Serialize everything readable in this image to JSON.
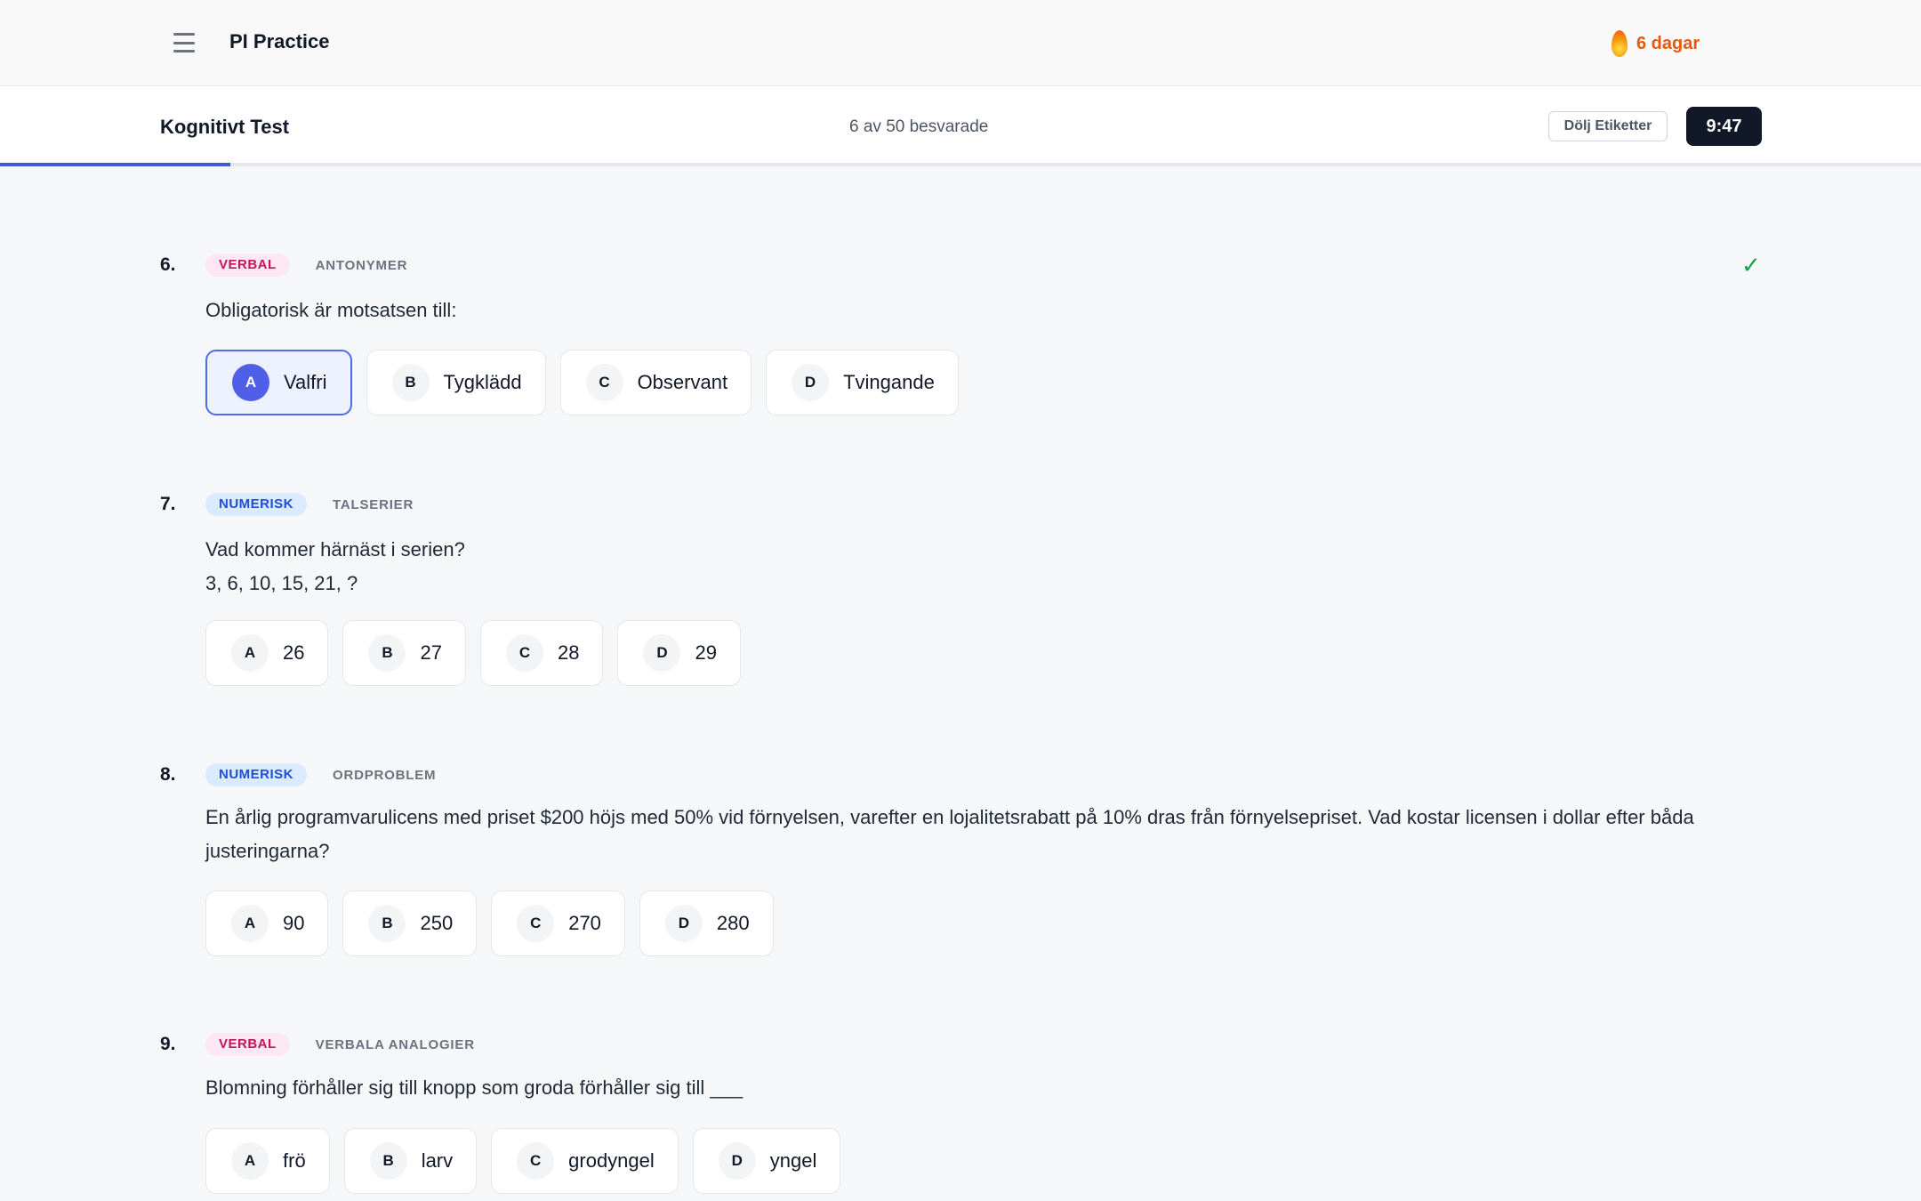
{
  "app": {
    "title": "PI Practice",
    "streak": "6 dagar"
  },
  "test": {
    "title": "Kognitivt Test",
    "answered": "6 av 50 besvarade",
    "hide_labels": "Dölj Etiketter",
    "timer": "9:47",
    "progress_percent": 12
  },
  "colors": {
    "accent": "#3b5bdb",
    "verbal": "#be185d",
    "numeric": "#1d4ed8",
    "streak": "#ea580c"
  },
  "questions": [
    {
      "num": "6.",
      "category": "VERBAL",
      "subcategory": "ANTONYMER",
      "answered_icon": "✓",
      "text": "Obligatorisk är motsatsen till:",
      "options": [
        {
          "letter": "A",
          "text": "Valfri",
          "selected": true
        },
        {
          "letter": "B",
          "text": "Tygklädd"
        },
        {
          "letter": "C",
          "text": "Observant"
        },
        {
          "letter": "D",
          "text": "Tvingande"
        }
      ]
    },
    {
      "num": "7.",
      "category": "NUMERISK",
      "subcategory": "TALSERIER",
      "text": "Vad kommer härnäst i serien?",
      "text2": "3, 6, 10, 15, 21, ?",
      "options": [
        {
          "letter": "A",
          "text": "26"
        },
        {
          "letter": "B",
          "text": "27"
        },
        {
          "letter": "C",
          "text": "28"
        },
        {
          "letter": "D",
          "text": "29"
        }
      ]
    },
    {
      "num": "8.",
      "category": "NUMERISK",
      "subcategory": "ORDPROBLEM",
      "text": "En årlig programvarulicens med priset $200 höjs med 50% vid förnyelsen, varefter en lojalitetsrabatt på 10% dras från förnyelsepriset. Vad kostar licensen i dollar efter båda justeringarna?",
      "options": [
        {
          "letter": "A",
          "text": "90"
        },
        {
          "letter": "B",
          "text": "250"
        },
        {
          "letter": "C",
          "text": "270"
        },
        {
          "letter": "D",
          "text": "280"
        }
      ]
    },
    {
      "num": "9.",
      "category": "VERBAL",
      "subcategory": "VERBALA ANALOGIER",
      "text": "Blomning förhåller sig till knopp som groda förhåller sig till ___",
      "options": [
        {
          "letter": "A",
          "text": "frö"
        },
        {
          "letter": "B",
          "text": "larv"
        },
        {
          "letter": "C",
          "text": "grodyngel"
        },
        {
          "letter": "D",
          "text": "yngel"
        }
      ]
    }
  ]
}
